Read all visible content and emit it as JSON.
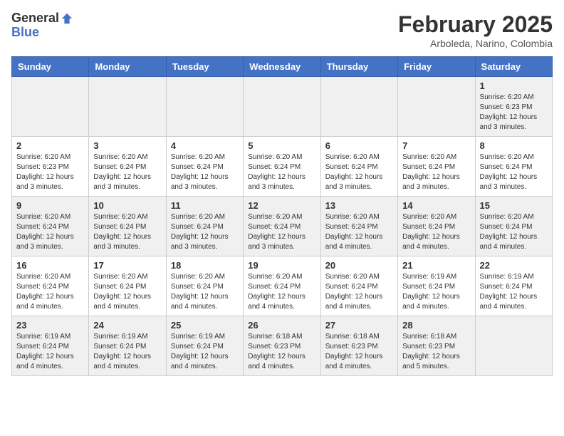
{
  "header": {
    "logo_general": "General",
    "logo_blue": "Blue",
    "month_title": "February 2025",
    "location": "Arboleda, Narino, Colombia"
  },
  "days_of_week": [
    "Sunday",
    "Monday",
    "Tuesday",
    "Wednesday",
    "Thursday",
    "Friday",
    "Saturday"
  ],
  "weeks": [
    [
      {
        "day": "",
        "info": ""
      },
      {
        "day": "",
        "info": ""
      },
      {
        "day": "",
        "info": ""
      },
      {
        "day": "",
        "info": ""
      },
      {
        "day": "",
        "info": ""
      },
      {
        "day": "",
        "info": ""
      },
      {
        "day": "1",
        "info": "Sunrise: 6:20 AM\nSunset: 6:23 PM\nDaylight: 12 hours\nand 3 minutes."
      }
    ],
    [
      {
        "day": "2",
        "info": "Sunrise: 6:20 AM\nSunset: 6:23 PM\nDaylight: 12 hours\nand 3 minutes."
      },
      {
        "day": "3",
        "info": "Sunrise: 6:20 AM\nSunset: 6:24 PM\nDaylight: 12 hours\nand 3 minutes."
      },
      {
        "day": "4",
        "info": "Sunrise: 6:20 AM\nSunset: 6:24 PM\nDaylight: 12 hours\nand 3 minutes."
      },
      {
        "day": "5",
        "info": "Sunrise: 6:20 AM\nSunset: 6:24 PM\nDaylight: 12 hours\nand 3 minutes."
      },
      {
        "day": "6",
        "info": "Sunrise: 6:20 AM\nSunset: 6:24 PM\nDaylight: 12 hours\nand 3 minutes."
      },
      {
        "day": "7",
        "info": "Sunrise: 6:20 AM\nSunset: 6:24 PM\nDaylight: 12 hours\nand 3 minutes."
      },
      {
        "day": "8",
        "info": "Sunrise: 6:20 AM\nSunset: 6:24 PM\nDaylight: 12 hours\nand 3 minutes."
      }
    ],
    [
      {
        "day": "9",
        "info": "Sunrise: 6:20 AM\nSunset: 6:24 PM\nDaylight: 12 hours\nand 3 minutes."
      },
      {
        "day": "10",
        "info": "Sunrise: 6:20 AM\nSunset: 6:24 PM\nDaylight: 12 hours\nand 3 minutes."
      },
      {
        "day": "11",
        "info": "Sunrise: 6:20 AM\nSunset: 6:24 PM\nDaylight: 12 hours\nand 3 minutes."
      },
      {
        "day": "12",
        "info": "Sunrise: 6:20 AM\nSunset: 6:24 PM\nDaylight: 12 hours\nand 3 minutes."
      },
      {
        "day": "13",
        "info": "Sunrise: 6:20 AM\nSunset: 6:24 PM\nDaylight: 12 hours\nand 4 minutes."
      },
      {
        "day": "14",
        "info": "Sunrise: 6:20 AM\nSunset: 6:24 PM\nDaylight: 12 hours\nand 4 minutes."
      },
      {
        "day": "15",
        "info": "Sunrise: 6:20 AM\nSunset: 6:24 PM\nDaylight: 12 hours\nand 4 minutes."
      }
    ],
    [
      {
        "day": "16",
        "info": "Sunrise: 6:20 AM\nSunset: 6:24 PM\nDaylight: 12 hours\nand 4 minutes."
      },
      {
        "day": "17",
        "info": "Sunrise: 6:20 AM\nSunset: 6:24 PM\nDaylight: 12 hours\nand 4 minutes."
      },
      {
        "day": "18",
        "info": "Sunrise: 6:20 AM\nSunset: 6:24 PM\nDaylight: 12 hours\nand 4 minutes."
      },
      {
        "day": "19",
        "info": "Sunrise: 6:20 AM\nSunset: 6:24 PM\nDaylight: 12 hours\nand 4 minutes."
      },
      {
        "day": "20",
        "info": "Sunrise: 6:20 AM\nSunset: 6:24 PM\nDaylight: 12 hours\nand 4 minutes."
      },
      {
        "day": "21",
        "info": "Sunrise: 6:19 AM\nSunset: 6:24 PM\nDaylight: 12 hours\nand 4 minutes."
      },
      {
        "day": "22",
        "info": "Sunrise: 6:19 AM\nSunset: 6:24 PM\nDaylight: 12 hours\nand 4 minutes."
      }
    ],
    [
      {
        "day": "23",
        "info": "Sunrise: 6:19 AM\nSunset: 6:24 PM\nDaylight: 12 hours\nand 4 minutes."
      },
      {
        "day": "24",
        "info": "Sunrise: 6:19 AM\nSunset: 6:24 PM\nDaylight: 12 hours\nand 4 minutes."
      },
      {
        "day": "25",
        "info": "Sunrise: 6:19 AM\nSunset: 6:24 PM\nDaylight: 12 hours\nand 4 minutes."
      },
      {
        "day": "26",
        "info": "Sunrise: 6:18 AM\nSunset: 6:23 PM\nDaylight: 12 hours\nand 4 minutes."
      },
      {
        "day": "27",
        "info": "Sunrise: 6:18 AM\nSunset: 6:23 PM\nDaylight: 12 hours\nand 4 minutes."
      },
      {
        "day": "28",
        "info": "Sunrise: 6:18 AM\nSunset: 6:23 PM\nDaylight: 12 hours\nand 5 minutes."
      },
      {
        "day": "",
        "info": ""
      }
    ]
  ]
}
